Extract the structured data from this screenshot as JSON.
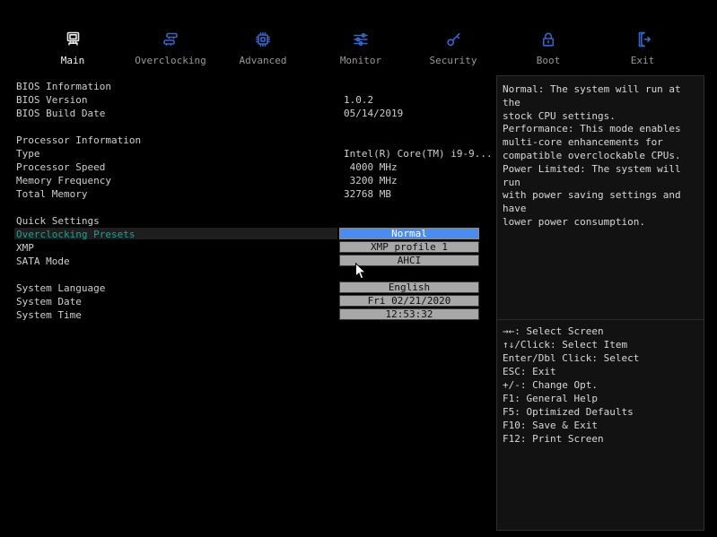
{
  "nav": {
    "tabs": [
      {
        "label": "Main",
        "icon": "computer-icon",
        "active": true
      },
      {
        "label": "Overclocking",
        "icon": "ram-icon",
        "active": false
      },
      {
        "label": "Advanced",
        "icon": "chip-icon",
        "active": false
      },
      {
        "label": "Monitor",
        "icon": "sliders-icon",
        "active": false
      },
      {
        "label": "Security",
        "icon": "key-icon",
        "active": false
      },
      {
        "label": "Boot",
        "icon": "padlock-icon",
        "active": false
      },
      {
        "label": "Exit",
        "icon": "exit-door-icon",
        "active": false
      }
    ]
  },
  "bios_info": {
    "title": "BIOS Information",
    "version_label": "BIOS Version",
    "version": "1.0.2",
    "build_date_label": "BIOS Build Date",
    "build_date": "05/14/2019"
  },
  "processor_info": {
    "title": "Processor Information",
    "type_label": "Type",
    "type": "Intel(R) Core(TM) i9-9...",
    "speed_label": "Processor Speed",
    "speed": " 4000 MHz",
    "mem_freq_label": "Memory Frequency",
    "mem_freq": " 3200 MHz",
    "total_mem_label": "Total Memory",
    "total_mem": "32768 MB"
  },
  "quick_settings": {
    "title": "Quick Settings",
    "overclocking_presets_label": "Overclocking Presets",
    "overclocking_presets_value": "Normal",
    "xmp_label": "XMP",
    "xmp_value": "XMP profile 1",
    "sata_label": "SATA Mode",
    "sata_value": "AHCI",
    "language_label": "System Language",
    "language_value": "English",
    "date_label": "System Date",
    "date_value": "Fri 02/21/2020",
    "time_label": "System Time",
    "time_value": "12:53:32"
  },
  "help_panel": {
    "description": "Normal: The system will run at the\nstock CPU settings.\nPerformance: This mode enables\nmulti-core enhancements for\ncompatible overclockable CPUs.\nPower Limited: The system will run\nwith power saving settings and have\nlower power consumption.",
    "shortcuts": [
      "→←: Select Screen",
      "↑↓/Click: Select Item",
      "Enter/Dbl Click: Select",
      "ESC: Exit",
      "+/-: Change Opt.",
      "F1: General Help",
      "F5: Optimized Defaults",
      "F10: Save & Exit",
      "F12: Print Screen"
    ]
  },
  "colors": {
    "selected_value_bg": "#4a8cf0",
    "highlight_text": "#17a298",
    "button_gray": "#a8a8a8",
    "icon_blue": "#3566cc"
  }
}
